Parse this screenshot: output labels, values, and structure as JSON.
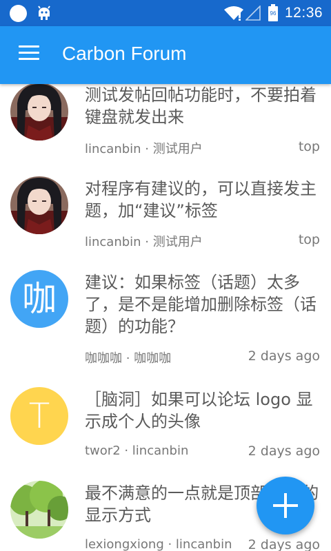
{
  "status_bar": {
    "time": "12:36",
    "battery_level": "96"
  },
  "app_bar": {
    "title": "Carbon Forum"
  },
  "topics": [
    {
      "title": "测试发帖回帖功能时，不要拍着键盘就发出来",
      "author": "lincanbin",
      "category": "测试用户",
      "meta": "lincanbin · 测试用户",
      "time": "top",
      "avatar": "anime-girl-avatar"
    },
    {
      "title": "对程序有建议的，可以直接发主题，加“建议”标签",
      "author": "lincanbin",
      "category": "测试用户",
      "meta": "lincanbin · 测试用户",
      "time": "top",
      "avatar": "anime-girl-avatar"
    },
    {
      "title": "建议：如果标签（话题）太多了，是不是能增加删除标签（话题）的功能？",
      "author": "咖咖咖",
      "category": "咖咖咖",
      "meta": "咖咖咖 · 咖咖咖",
      "time": "2 days ago",
      "avatar_letter": "咖",
      "avatar_color": "#42a5f5"
    },
    {
      "title": "［脑洞］如果可以论坛 logo 显示成个人的头像",
      "author": "twor2",
      "category": "lincanbin",
      "meta": "twor2 · lincanbin",
      "time": "2 days ago",
      "avatar_letter": "T",
      "avatar_color": "#ffd54f"
    },
    {
      "title": "最不满意的一点就是顶部logo的显示方式",
      "author": "lexiongxiong",
      "category": "lincanbin",
      "meta": "lexiongxiong · lincanbin",
      "time": "2 days ago",
      "avatar": "green-trees-avatar"
    }
  ],
  "colors": {
    "primary": "#2196f3",
    "status_bar": "#1769cc"
  }
}
